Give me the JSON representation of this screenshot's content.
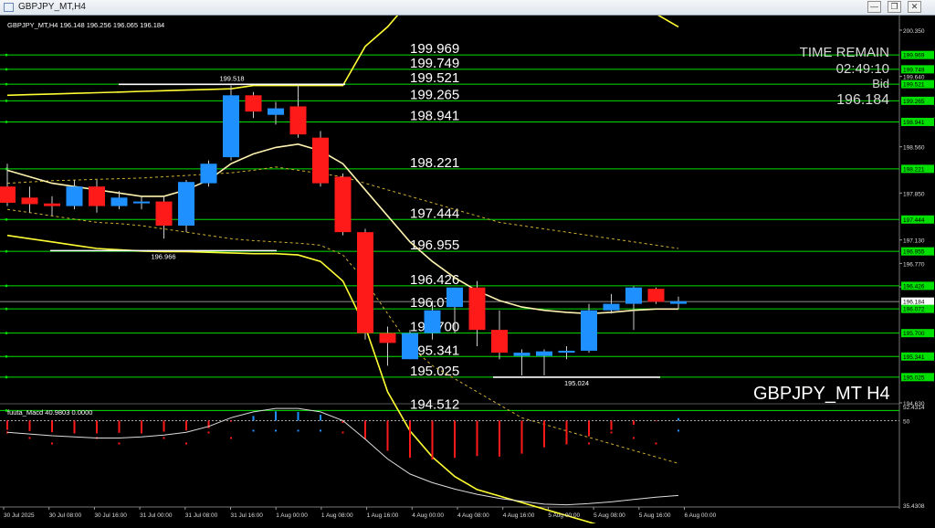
{
  "window": {
    "title": "GBPJPY_MT,H4",
    "buttons": {
      "minimize": "—",
      "restore": "❐",
      "close": "✕"
    }
  },
  "symbol_line": "GBPJPY_MT,H4  196.148 196.256 196.065 196.184",
  "watermark": "GBPJPY_MT H4",
  "time_remain": {
    "label": "TIME REMAIN",
    "value": "02:49:10",
    "bid_label": "Bid",
    "bid_value": "196.184"
  },
  "macd": {
    "label": "fuuta_Macd 40.9803  0.0000"
  },
  "colors": {
    "bull": "#1e90ff",
    "bear": "#ff1a1a",
    "level_line": "#00e000",
    "bands": "#ffff33",
    "ma": "#fff3b0",
    "grid": "#1a1a1a"
  },
  "chart_data": [
    {
      "type": "candlestick",
      "symbol": "GBPJPY_MT",
      "timeframe": "H4",
      "ylim": [
        194.63,
        200.35
      ],
      "y_ticks": [
        "200.350",
        "199.640",
        "198.560",
        "197.850",
        "197.130",
        "196.770",
        "196.410",
        "194.630"
      ],
      "price_labels": [
        "199.969",
        "199.749",
        "199.521",
        "199.265",
        "198.941",
        "198.221",
        "197.444",
        "196.955",
        "196.426",
        "196.184",
        "196.072",
        "195.700",
        "195.341",
        "195.025"
      ],
      "levels": [
        199.969,
        199.749,
        199.521,
        199.265,
        198.941,
        198.221,
        197.444,
        196.955,
        196.426,
        196.072,
        195.7,
        195.341,
        195.025,
        194.512
      ],
      "level_texts": [
        "199.969",
        "199.749",
        "199.521",
        "199.265",
        "198.941",
        "198.221",
        "197.444",
        "196.955",
        "196.426",
        "196.072",
        "195.700",
        "195.341",
        "195.025",
        "194.512"
      ],
      "markers": [
        {
          "label": "199.518",
          "value": 199.518
        },
        {
          "label": "196.966",
          "value": 196.966
        },
        {
          "label": "195.024",
          "value": 195.024
        }
      ],
      "x_labels": [
        "30 Jul 2025",
        "30 Jul 08:00",
        "30 Jul 16:00",
        "31 Jul 00:00",
        "31 Jul 08:00",
        "31 Jul 16:00",
        "1 Aug 00:00",
        "1 Aug 08:00",
        "1 Aug 16:00",
        "4 Aug 00:00",
        "4 Aug 08:00",
        "4 Aug 16:00",
        "5 Aug 00:00",
        "5 Aug 08:00",
        "5 Aug 16:00",
        "6 Aug 00:00"
      ],
      "candles": [
        {
          "o": 197.95,
          "h": 198.3,
          "l": 197.65,
          "c": 197.7
        },
        {
          "o": 197.78,
          "h": 197.95,
          "l": 197.55,
          "c": 197.68
        },
        {
          "o": 197.69,
          "h": 197.8,
          "l": 197.5,
          "c": 197.65
        },
        {
          "o": 197.65,
          "h": 198.05,
          "l": 197.6,
          "c": 197.95
        },
        {
          "o": 197.95,
          "h": 198.05,
          "l": 197.55,
          "c": 197.65
        },
        {
          "o": 197.65,
          "h": 197.88,
          "l": 197.6,
          "c": 197.78
        },
        {
          "o": 197.7,
          "h": 197.8,
          "l": 197.6,
          "c": 197.72
        },
        {
          "o": 197.72,
          "h": 197.8,
          "l": 197.15,
          "c": 197.35
        },
        {
          "o": 197.35,
          "h": 198.05,
          "l": 197.25,
          "c": 198.02
        },
        {
          "o": 198.0,
          "h": 198.35,
          "l": 197.95,
          "c": 198.3
        },
        {
          "o": 198.4,
          "h": 199.5,
          "l": 198.35,
          "c": 199.35
        },
        {
          "o": 199.35,
          "h": 199.4,
          "l": 199.0,
          "c": 199.1
        },
        {
          "o": 199.05,
          "h": 199.25,
          "l": 198.9,
          "c": 199.15
        },
        {
          "o": 199.18,
          "h": 199.5,
          "l": 198.7,
          "c": 198.75
        },
        {
          "o": 198.7,
          "h": 198.8,
          "l": 197.95,
          "c": 198.0
        },
        {
          "o": 198.1,
          "h": 198.15,
          "l": 197.2,
          "c": 197.25
        },
        {
          "o": 197.25,
          "h": 197.3,
          "l": 195.6,
          "c": 195.7
        },
        {
          "o": 195.7,
          "h": 195.8,
          "l": 195.2,
          "c": 195.55
        },
        {
          "o": 195.3,
          "h": 195.75,
          "l": 195.3,
          "c": 195.7
        },
        {
          "o": 195.7,
          "h": 196.2,
          "l": 195.6,
          "c": 196.05
        },
        {
          "o": 196.1,
          "h": 196.4,
          "l": 195.7,
          "c": 196.4
        },
        {
          "o": 196.4,
          "h": 196.5,
          "l": 195.5,
          "c": 195.75
        },
        {
          "o": 195.75,
          "h": 196.05,
          "l": 195.3,
          "c": 195.4
        },
        {
          "o": 195.35,
          "h": 195.45,
          "l": 195.05,
          "c": 195.4
        },
        {
          "o": 195.35,
          "h": 195.45,
          "l": 195.05,
          "c": 195.42
        },
        {
          "o": 195.4,
          "h": 195.5,
          "l": 195.3,
          "c": 195.43
        },
        {
          "o": 195.43,
          "h": 196.15,
          "l": 195.4,
          "c": 196.05
        },
        {
          "o": 196.05,
          "h": 196.3,
          "l": 196.0,
          "c": 196.15
        },
        {
          "o": 196.15,
          "h": 196.42,
          "l": 195.75,
          "c": 196.4
        },
        {
          "o": 196.38,
          "h": 196.4,
          "l": 196.15,
          "c": 196.18
        },
        {
          "o": 196.15,
          "h": 196.26,
          "l": 196.07,
          "c": 196.19
        }
      ],
      "bands": {
        "upper_outer": [
          199.35,
          199.36,
          199.37,
          199.38,
          199.39,
          199.4,
          199.41,
          199.42,
          199.43,
          199.44,
          199.45,
          199.5,
          199.5,
          199.5,
          199.5,
          199.5,
          200.1,
          200.4,
          200.8,
          200.9,
          200.95,
          200.98,
          201.0,
          200.98,
          200.98,
          200.96,
          200.92,
          200.86,
          200.76,
          200.6,
          200.4
        ],
        "upper": [
          198.0,
          198.02,
          198.04,
          198.05,
          198.06,
          198.07,
          198.08,
          198.1,
          198.12,
          198.14,
          198.16,
          198.2,
          198.25,
          198.2,
          198.15,
          198.1,
          198.0,
          197.9,
          197.8,
          197.7,
          197.6,
          197.5,
          197.4,
          197.35,
          197.3,
          197.25,
          197.2,
          197.15,
          197.1,
          197.05,
          197.0
        ],
        "ma": [
          198.2,
          198.1,
          198.0,
          197.95,
          197.9,
          197.85,
          197.8,
          197.8,
          197.9,
          198.05,
          198.3,
          198.45,
          198.55,
          198.6,
          198.5,
          198.3,
          197.9,
          197.5,
          197.1,
          196.8,
          196.55,
          196.35,
          196.2,
          196.1,
          196.05,
          196.02,
          196.0,
          196.02,
          196.05,
          196.07,
          196.07
        ],
        "lower": [
          197.6,
          197.55,
          197.5,
          197.45,
          197.4,
          197.38,
          197.35,
          197.3,
          197.25,
          197.2,
          197.15,
          197.12,
          197.1,
          197.08,
          197.05,
          196.9,
          196.5,
          196.0,
          195.5,
          195.2,
          195.0,
          194.8,
          194.6,
          194.4,
          194.3,
          194.2,
          194.1,
          194.0,
          193.9,
          193.8,
          193.7
        ],
        "lower_outer": [
          197.2,
          197.15,
          197.1,
          197.05,
          197.0,
          196.98,
          196.96,
          196.95,
          196.95,
          196.94,
          196.93,
          196.92,
          196.92,
          196.9,
          196.8,
          196.5,
          195.8,
          194.8,
          194.2,
          193.8,
          193.5,
          193.3,
          193.2,
          193.1,
          193.0,
          192.9,
          192.8,
          192.7,
          192.6,
          192.5,
          192.4
        ]
      }
    },
    {
      "type": "bar",
      "name": "fuuta_Macd",
      "ylim": [
        35.4308,
        52.4314
      ],
      "y_ticks": [
        "52.4314",
        "50",
        "35.4308"
      ],
      "values": [
        48.4,
        48.2,
        48.0,
        47.9,
        47.8,
        47.9,
        48.0,
        48.1,
        48.3,
        48.7,
        49.8,
        50.8,
        51.6,
        51.5,
        51.0,
        49.6,
        47.0,
        44.8,
        43.6,
        43.3,
        43.6,
        43.9,
        43.8,
        44.3,
        45.4,
        45.9,
        47.3,
        48.4,
        49.3,
        49.9,
        50.4
      ],
      "line": [
        48.0,
        47.7,
        47.4,
        47.2,
        47.0,
        47.0,
        47.2,
        47.5,
        48.0,
        49.0,
        50.5,
        51.5,
        52.1,
        52.1,
        51.5,
        50.0,
        46.8,
        43.4,
        40.8,
        39.3,
        38.2,
        37.3,
        36.6,
        36.1,
        35.6,
        35.5,
        35.7,
        36.0,
        36.4,
        36.8,
        37.1
      ]
    }
  ]
}
